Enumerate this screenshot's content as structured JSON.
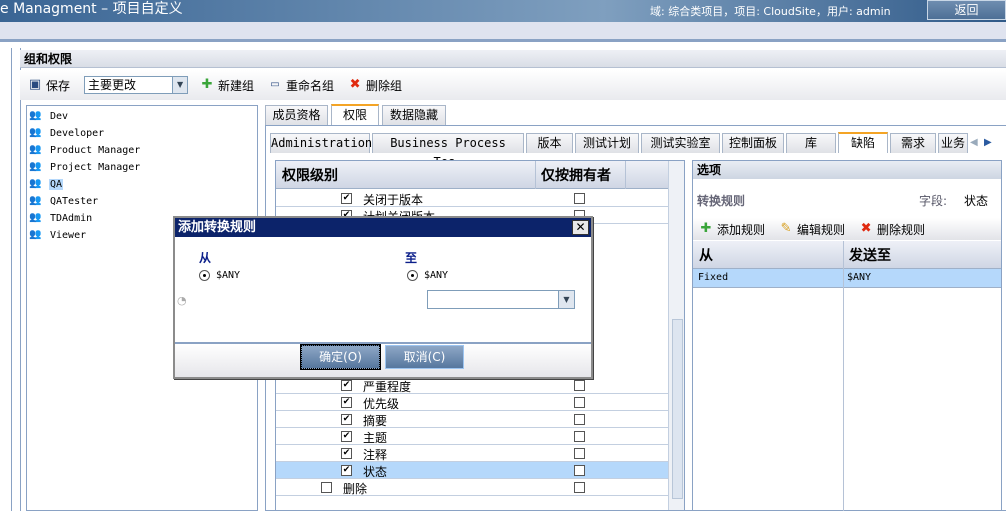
{
  "header": {
    "title": "e Managment – 项目自定义",
    "context": "域: 综合类项目，项目: CloudSite，用户: admin",
    "back_label": "返回"
  },
  "section": {
    "title": "组和权限"
  },
  "toolbar": {
    "save": "保存",
    "mode": "主要更改",
    "new_group": "新建组",
    "rename_group": "重命名组",
    "delete_group": "删除组"
  },
  "groups": [
    {
      "name": "Dev"
    },
    {
      "name": "Developer"
    },
    {
      "name": "Product Manager"
    },
    {
      "name": "Project Manager"
    },
    {
      "name": "QA",
      "selected": true
    },
    {
      "name": "QATester"
    },
    {
      "name": "TDAdmin"
    },
    {
      "name": "Viewer"
    }
  ],
  "tabs": [
    "成员资格",
    "权限",
    "数据隐藏"
  ],
  "active_tab": "权限",
  "module_tabs": [
    "Administration",
    "Business Process Tes…",
    "版本",
    "测试计划",
    "测试实验室",
    "控制面板",
    "库",
    "缺陷",
    "需求",
    "业务"
  ],
  "active_module_tab": "缺陷",
  "perm_table": {
    "col_level": "权限级别",
    "col_owner": "仅按拥有者",
    "rows_top": [
      {
        "label": "关闭于版本",
        "checked": true,
        "owner": false
      },
      {
        "label": "计划关闭版本",
        "checked": true,
        "owner": false
      }
    ],
    "rows_bottom": [
      {
        "label": "严重程度",
        "checked": true,
        "owner": false
      },
      {
        "label": "优先级",
        "checked": true,
        "owner": false
      },
      {
        "label": "摘要",
        "checked": true,
        "owner": false
      },
      {
        "label": "主题",
        "checked": true,
        "owner": false
      },
      {
        "label": "注释",
        "checked": true,
        "owner": false
      },
      {
        "label": "状态",
        "checked": true,
        "owner": false,
        "selected": true
      }
    ],
    "delete_row": {
      "label": "删除",
      "checked": false,
      "owner": false
    }
  },
  "options": {
    "title": "选项",
    "rules_label": "转换规则",
    "field_label": "字段:",
    "field_value": "状态",
    "add_rule": "添加规则",
    "edit_rule": "编辑规则",
    "delete_rule": "删除规则",
    "col_from": "从",
    "col_to": "发送至",
    "rows": [
      {
        "from": "Fixed",
        "to": "$ANY"
      }
    ]
  },
  "dialog": {
    "title": "添加转换规则",
    "from_label": "从",
    "from_value": "$ANY",
    "to_label": "至",
    "to_value": "$ANY",
    "to_select": "",
    "ok": "确定(O)",
    "cancel": "取消(C)"
  }
}
